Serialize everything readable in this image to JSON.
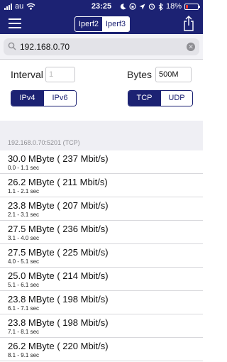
{
  "status_bar": {
    "carrier": "au",
    "time": "23:25",
    "battery": "18%",
    "battery_level": 0.18,
    "icons": [
      "signal-icon",
      "wifi-icon",
      "moon-icon",
      "lock-rotation-icon",
      "location-icon",
      "alarm-icon",
      "bluetooth-icon",
      "battery-icon"
    ]
  },
  "nav": {
    "tabs": [
      {
        "label": "Iperf2",
        "active": false
      },
      {
        "label": "Iperf3",
        "active": true
      }
    ],
    "icons": [
      "menu-icon",
      "share-icon"
    ]
  },
  "search": {
    "value": "192.168.0.70",
    "icons": [
      "search-icon",
      "clear-icon"
    ]
  },
  "settings": {
    "interval_label": "Interval",
    "interval_value": "1",
    "bytes_label": "Bytes",
    "bytes_value": "500M",
    "ip_version": [
      {
        "label": "IPv4",
        "active": true
      },
      {
        "label": "IPv6",
        "active": false
      }
    ],
    "protocol": [
      {
        "label": "TCP",
        "active": true
      },
      {
        "label": "UDP",
        "active": false
      }
    ]
  },
  "section_header": "192.168.0.70:5201 (TCP)",
  "results": [
    {
      "main": "30.0 MByte ( 237 Mbit/s)",
      "interval": "0.0 - 1.1 sec"
    },
    {
      "main": "26.2 MByte ( 211 Mbit/s)",
      "interval": "1.1 - 2.1 sec"
    },
    {
      "main": "23.8 MByte ( 207 Mbit/s)",
      "interval": "2.1 - 3.1 sec"
    },
    {
      "main": "27.5 MByte ( 236 Mbit/s)",
      "interval": "3.1 - 4.0 sec"
    },
    {
      "main": "27.5 MByte ( 225 Mbit/s)",
      "interval": "4.0 - 5.1 sec"
    },
    {
      "main": "25.0 MByte ( 214 Mbit/s)",
      "interval": "5.1 - 6.1 sec"
    },
    {
      "main": "23.8 MByte ( 198 Mbit/s)",
      "interval": "6.1 - 7.1 sec"
    },
    {
      "main": "23.8 MByte ( 198 Mbit/s)",
      "interval": "7.1 - 8.1 sec"
    },
    {
      "main": "26.2 MByte ( 220 Mbit/s)",
      "interval": "8.1 - 9.1 sec"
    }
  ],
  "colors": {
    "nav_bg": "#1c2273",
    "accent": "#1c2273",
    "battery_low": "#ff3b30"
  }
}
